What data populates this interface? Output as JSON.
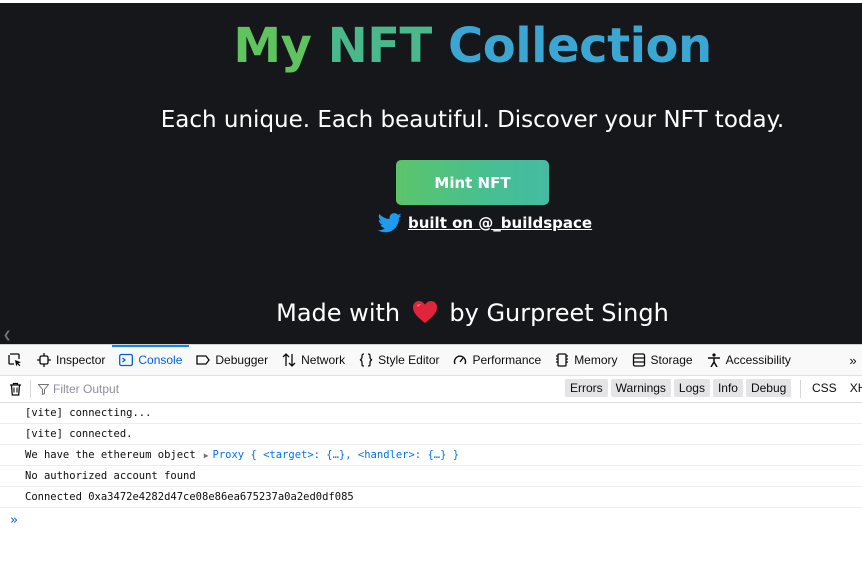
{
  "page": {
    "title_words": [
      "My",
      "NFT",
      "Collection"
    ],
    "subtitle": "Each unique. Each beautiful. Discover your NFT today.",
    "mint_button": "Mint NFT",
    "built_on_link": "built on @_buildspace",
    "footer_before": "Made with",
    "footer_after": "by Gurpreet Singh",
    "colors": {
      "background": "#16171b",
      "title_green": "#5fc35f",
      "title_blue": "#3ba6d2",
      "button": "#47bf92"
    }
  },
  "devtools": {
    "tabs": [
      {
        "label": "Inspector",
        "icon": "inspector-icon"
      },
      {
        "label": "Console",
        "icon": "console-icon",
        "active": true
      },
      {
        "label": "Debugger",
        "icon": "debugger-icon"
      },
      {
        "label": "Network",
        "icon": "network-icon"
      },
      {
        "label": "Style Editor",
        "icon": "style-editor-icon"
      },
      {
        "label": "Performance",
        "icon": "performance-icon"
      },
      {
        "label": "Memory",
        "icon": "memory-icon"
      },
      {
        "label": "Storage",
        "icon": "storage-icon"
      },
      {
        "label": "Accessibility",
        "icon": "accessibility-icon"
      }
    ],
    "filter_placeholder": "Filter Output",
    "levels": [
      "Errors",
      "Warnings",
      "Logs",
      "Info",
      "Debug"
    ],
    "types": [
      "CSS",
      "XHR"
    ],
    "messages": [
      {
        "text": "[vite] connecting..."
      },
      {
        "text": "[vite] connected."
      },
      {
        "text": "We have the ethereum object",
        "object": "Proxy { <target>: {…}, <handler>: {…} }"
      },
      {
        "text": "No authorized account found"
      },
      {
        "text": "Connected 0xa3472e4282d47ce08e86ea675237a0a2ed0df085"
      }
    ]
  }
}
